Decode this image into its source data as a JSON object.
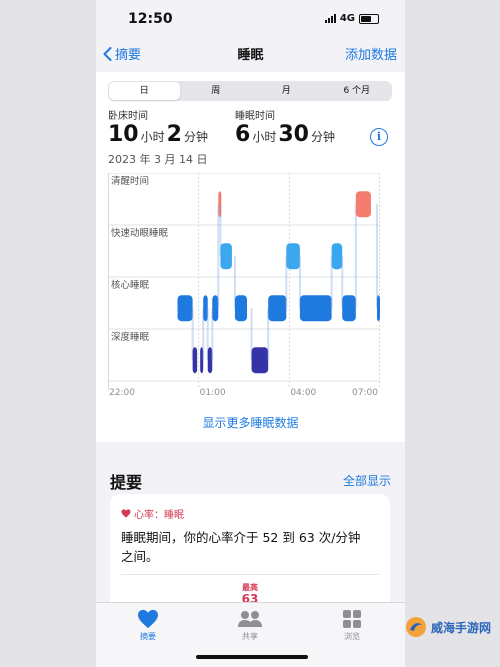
{
  "status": {
    "time": "12:50",
    "network": "4G"
  },
  "nav": {
    "back_label": "摘要",
    "title": "睡眠",
    "add_label": "添加数据"
  },
  "segments": [
    "日",
    "周",
    "月",
    "6 个月"
  ],
  "stats": {
    "in_bed": {
      "label": "卧床时间",
      "hours": "10",
      "hours_unit": "小时",
      "minutes": "2",
      "minutes_unit": "分钟"
    },
    "asleep": {
      "label": "睡眠时间",
      "hours": "6",
      "hours_unit": "小时",
      "minutes": "30",
      "minutes_unit": "分钟"
    },
    "date": "2023 年 3 月 14 日"
  },
  "chart_data": {
    "type": "timeline",
    "stages": [
      "清醒时间",
      "快速动眼睡眠",
      "核心睡眠",
      "深度睡眠"
    ],
    "x_ticks": [
      "22:00",
      "01:00",
      "04:00",
      "07:00"
    ],
    "x_range_hours": [
      22,
      31
    ],
    "stage_colors": {
      "清醒时间": "#f47c6c",
      "快速动眼睡眠": "#3ba7ee",
      "核心睡眠": "#1f7ae0",
      "深度睡眠": "#3434a8"
    },
    "segments": [
      {
        "stage": "核心睡眠",
        "start": 24.3,
        "end": 24.8
      },
      {
        "stage": "深度睡眠",
        "start": 24.8,
        "end": 24.95
      },
      {
        "stage": "深度睡眠",
        "start": 25.05,
        "end": 25.15
      },
      {
        "stage": "核心睡眠",
        "start": 25.15,
        "end": 25.3
      },
      {
        "stage": "深度睡眠",
        "start": 25.3,
        "end": 25.45
      },
      {
        "stage": "核心睡眠",
        "start": 25.45,
        "end": 25.65
      },
      {
        "stage": "清醒时间",
        "start": 25.65,
        "end": 25.72
      },
      {
        "stage": "快速动眼睡眠",
        "start": 25.72,
        "end": 26.1
      },
      {
        "stage": "核心睡眠",
        "start": 26.2,
        "end": 26.6
      },
      {
        "stage": "深度睡眠",
        "start": 26.75,
        "end": 27.3
      },
      {
        "stage": "核心睡眠",
        "start": 27.3,
        "end": 27.9
      },
      {
        "stage": "快速动眼睡眠",
        "start": 27.9,
        "end": 28.35
      },
      {
        "stage": "核心睡眠",
        "start": 28.35,
        "end": 29.4
      },
      {
        "stage": "快速动眼睡眠",
        "start": 29.4,
        "end": 29.75
      },
      {
        "stage": "核心睡眠",
        "start": 29.75,
        "end": 30.2
      },
      {
        "stage": "清醒时间",
        "start": 30.2,
        "end": 30.7
      },
      {
        "stage": "核心睡眠",
        "start": 30.9,
        "end": 31.0
      }
    ]
  },
  "more_link": "显示更多睡眠数据",
  "summary": {
    "title": "提要",
    "show_all": "全部显示",
    "card": {
      "header": "心率：睡眠",
      "text": "睡眠期间，你的心率介于 52 到 63 次/分钟之间。",
      "max_label": "最高",
      "max_value": "63"
    }
  },
  "tabbar": [
    {
      "label": "摘要",
      "icon": "heart-icon",
      "active": true
    },
    {
      "label": "共享",
      "icon": "people-icon",
      "active": false
    },
    {
      "label": "浏览",
      "icon": "grid-icon",
      "active": false
    }
  ],
  "watermark": {
    "text": "威海手游网"
  },
  "colors": {
    "accent": "#1f7ae0",
    "heart": "#d43b52"
  }
}
